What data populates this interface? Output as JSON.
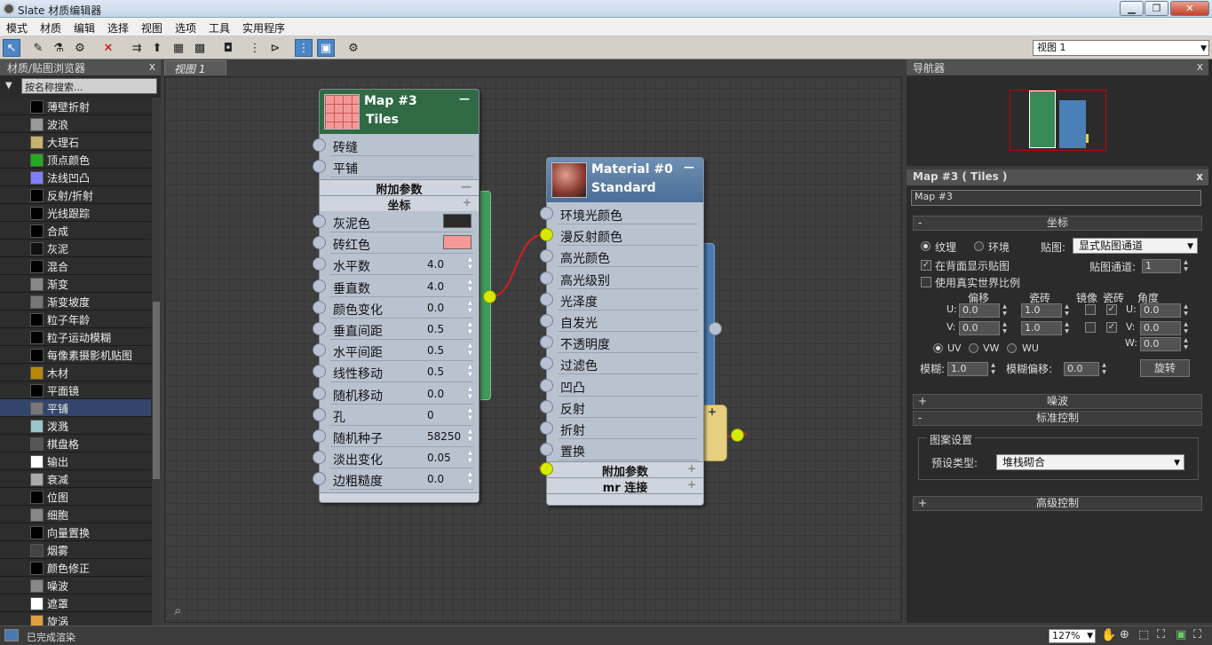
{
  "window": {
    "title": "Slate 材质编辑器",
    "min": "▁",
    "max": "❐",
    "close": "✕"
  },
  "menu": [
    "模式",
    "材质",
    "编辑",
    "选择",
    "视图",
    "选项",
    "工具",
    "实用程序"
  ],
  "view_select": "视图 1",
  "browser": {
    "title": "材质/贴图浏览器",
    "close": "x",
    "search_placeholder": "按名称搜索...",
    "items": [
      {
        "label": "薄壁折射",
        "color": "#000000"
      },
      {
        "label": "波浪",
        "color": "#9a9a9a"
      },
      {
        "label": "大理石",
        "color": "#c8b270"
      },
      {
        "label": "顶点颜色",
        "color": "#22aa22"
      },
      {
        "label": "法线凹凸",
        "color": "#8080ff"
      },
      {
        "label": "反射/折射",
        "color": "#000000"
      },
      {
        "label": "光线跟踪",
        "color": "#000000"
      },
      {
        "label": "合成",
        "color": "#000000"
      },
      {
        "label": "灰泥",
        "color": "#111111"
      },
      {
        "label": "混合",
        "color": "#000000"
      },
      {
        "label": "渐变",
        "color": "#888888"
      },
      {
        "label": "渐变坡度",
        "color": "#777777"
      },
      {
        "label": "粒子年龄",
        "color": "#000000"
      },
      {
        "label": "粒子运动模糊",
        "color": "#000000"
      },
      {
        "label": "每像素摄影机贴图",
        "color": "#000000"
      },
      {
        "label": "木材",
        "color": "#b8860b"
      },
      {
        "label": "平面镜",
        "color": "#000000"
      },
      {
        "label": "平铺",
        "color": "#777777"
      },
      {
        "label": "泼溅",
        "color": "#9cc4cc"
      },
      {
        "label": "棋盘格",
        "color": "#555555"
      },
      {
        "label": "输出",
        "color": "#ffffff"
      },
      {
        "label": "衰减",
        "color": "#aaaaaa"
      },
      {
        "label": "位图",
        "color": "#000000"
      },
      {
        "label": "细胞",
        "color": "#888888"
      },
      {
        "label": "向量置换",
        "color": "#000000"
      },
      {
        "label": "烟雾",
        "color": "#444444"
      },
      {
        "label": "颜色修正",
        "color": "#000000"
      },
      {
        "label": "噪波",
        "color": "#888888"
      },
      {
        "label": "遮罩",
        "color": "#ffffff"
      },
      {
        "label": "旋涡",
        "color": "#e0a040"
      }
    ]
  },
  "view_tab": "视图 1",
  "tiles_node": {
    "title1": "Map #3",
    "title2": "Tiles",
    "collapse": "—",
    "slots": [
      "砖缝",
      "平铺"
    ],
    "extra_section": "附加参数",
    "extra_pm": "—",
    "coord_section": "坐标",
    "coord_pm": "+",
    "params": [
      {
        "label": "灰泥色",
        "value": ""
      },
      {
        "label": "砖红色",
        "value": ""
      },
      {
        "label": "水平数",
        "value": "4.0"
      },
      {
        "label": "垂直数",
        "value": "4.0"
      },
      {
        "label": "颜色变化",
        "value": "0.0"
      },
      {
        "label": "垂直间距",
        "value": "0.5"
      },
      {
        "label": "水平间距",
        "value": "0.5"
      },
      {
        "label": "线性移动",
        "value": "0.5"
      },
      {
        "label": "随机移动",
        "value": "0.0"
      },
      {
        "label": "孔",
        "value": "0"
      },
      {
        "label": "随机种子",
        "value": "58250"
      },
      {
        "label": "淡出变化",
        "value": "0.05"
      },
      {
        "label": "边粗糙度",
        "value": "0.0"
      }
    ],
    "mortar_color": "#2a2a2a",
    "brick_color": "#f59898"
  },
  "material_node": {
    "title1": "Material #0",
    "title2": "Standard",
    "collapse": "—",
    "slots": [
      "环境光颜色",
      "漫反射颜色",
      "高光颜色",
      "高光级别",
      "光泽度",
      "自发光",
      "不透明度",
      "过滤色",
      "凹凸",
      "反射",
      "折射",
      "置换"
    ],
    "extra_section": "附加参数",
    "extra_pm": "+",
    "mr_section": "mr 连接",
    "mr_pm": "+"
  },
  "navigator": {
    "title": "导航器",
    "close": "x"
  },
  "params": {
    "title": "Map #3 ( Tiles )",
    "close": "x",
    "name": "Map #3",
    "coord": {
      "title": "坐标",
      "pm": "-",
      "texture": "纹理",
      "env": "环境",
      "map_label": "贴图:",
      "map_value": "显式贴图通道",
      "show_back": "在背面显示贴图",
      "real_world": "使用真实世界比例",
      "channel_label": "贴图通道:",
      "channel": "1",
      "offset": "偏移",
      "tiling": "瓷砖",
      "mirror": "镜像",
      "tile": "瓷砖",
      "angle": "角度",
      "u": "U:",
      "v": "V:",
      "w": "W:",
      "u_offset": "0.0",
      "v_offset": "0.0",
      "u_tiling": "1.0",
      "v_tiling": "1.0",
      "u_angle": "0.0",
      "v_angle": "0.0",
      "w_angle": "0.0",
      "uv": "UV",
      "vw": "VW",
      "wu": "WU",
      "blur_label": "模糊:",
      "blur": "1.0",
      "blur_offset_label": "模糊偏移:",
      "blur_offset": "0.0",
      "rotate": "旋转"
    },
    "noise": {
      "title": "噪波",
      "pm": "+"
    },
    "std": {
      "title": "标准控制",
      "pm": "-",
      "group": "图案设置",
      "preset_label": "预设类型:",
      "preset": "堆栈砌合"
    },
    "adv": {
      "title": "高级控制",
      "pm": "+"
    }
  },
  "status": {
    "text": "已完成渲染",
    "zoom": "127%"
  }
}
